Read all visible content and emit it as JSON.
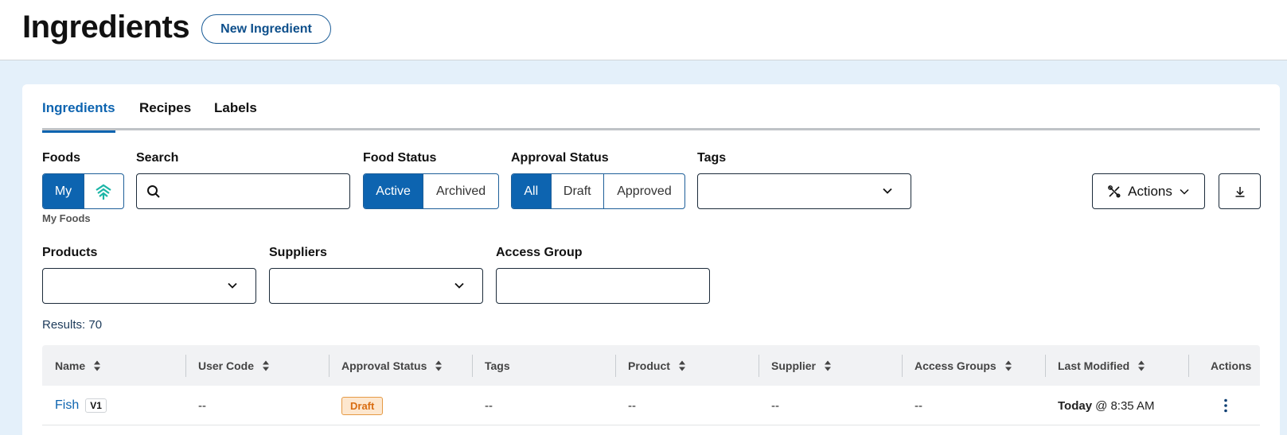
{
  "header": {
    "title": "Ingredients",
    "new_button": "New Ingredient"
  },
  "tabs": [
    {
      "label": "Ingredients",
      "active": true
    },
    {
      "label": "Recipes",
      "active": false
    },
    {
      "label": "Labels",
      "active": false
    }
  ],
  "filters": {
    "foods": {
      "label": "Foods",
      "options": [
        "My"
      ],
      "selected": "My",
      "hint": "My Foods"
    },
    "search": {
      "label": "Search",
      "value": "",
      "placeholder": ""
    },
    "food_status": {
      "label": "Food Status",
      "options": [
        "Active",
        "Archived"
      ],
      "selected": "Active"
    },
    "approval_status": {
      "label": "Approval Status",
      "options": [
        "All",
        "Draft",
        "Approved"
      ],
      "selected": "All"
    },
    "tags": {
      "label": "Tags",
      "value": ""
    },
    "products": {
      "label": "Products",
      "value": ""
    },
    "suppliers": {
      "label": "Suppliers",
      "value": ""
    },
    "access_group": {
      "label": "Access Group",
      "value": ""
    }
  },
  "toolbar": {
    "actions_label": "Actions"
  },
  "results": "Results: 70",
  "table": {
    "columns": [
      "Name",
      "User Code",
      "Approval Status",
      "Tags",
      "Product",
      "Supplier",
      "Access Groups",
      "Last Modified",
      "Actions"
    ],
    "rows": [
      {
        "name": "Fish",
        "version": "V1",
        "user_code": "--",
        "approval_status": "Draft",
        "tags": "--",
        "product": "--",
        "supplier": "--",
        "access_groups": "--",
        "last_modified_day": "Today",
        "last_modified_time": "@ 8:35 AM"
      }
    ]
  },
  "colors": {
    "primary": "#0d64b0",
    "page_bg": "#e4f0fa",
    "draft_badge_bg": "#fde7cf",
    "draft_badge_text": "#d96d12",
    "logo_teal": "#1bb5a6"
  },
  "icons": [
    "search-icon",
    "chevron-down-icon",
    "tools-icon",
    "download-icon",
    "sort-icon",
    "kebab-icon",
    "brand-logo-icon"
  ]
}
